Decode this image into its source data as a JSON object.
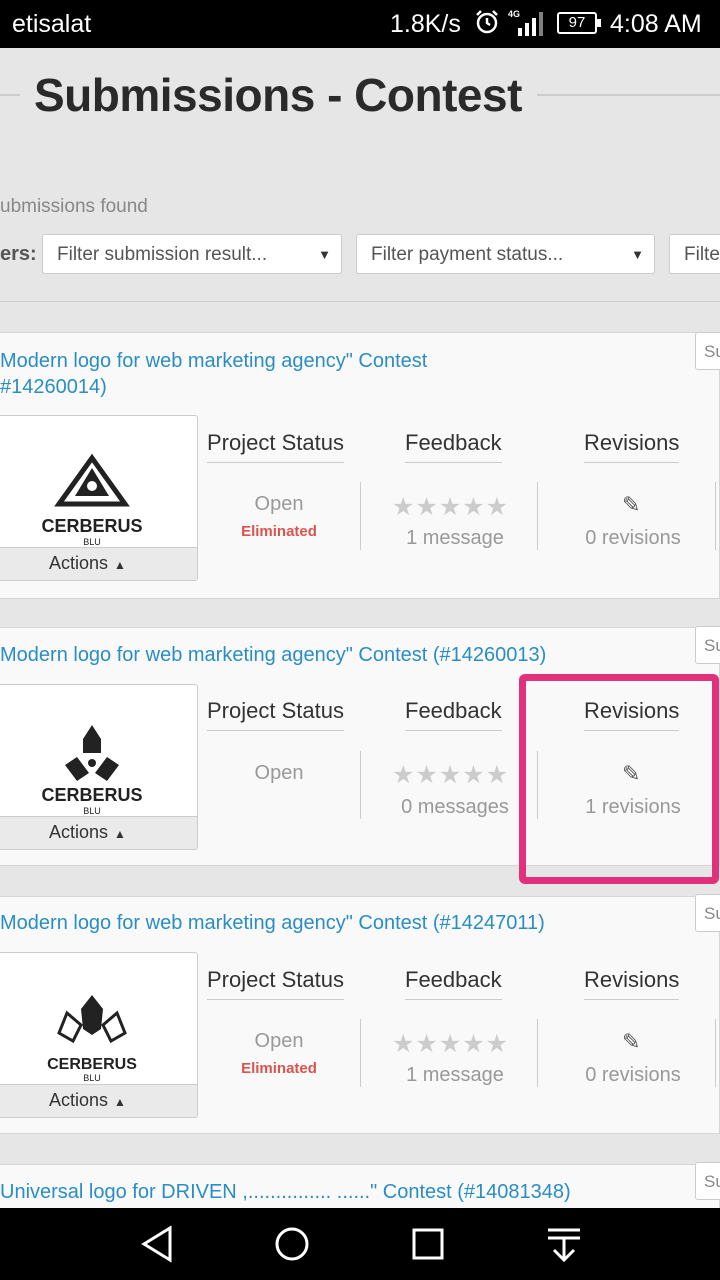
{
  "status_bar": {
    "carrier": "etisalat",
    "speed": "1.8K/s",
    "network": "4G",
    "battery": "97",
    "time": "4:08 AM"
  },
  "page": {
    "title": "Submissions - Contest",
    "found_text": "ubmissions found",
    "filters_label": "ers:",
    "filters": [
      {
        "placeholder": "Filter submission result..."
      },
      {
        "placeholder": "Filter payment status..."
      },
      {
        "placeholder": "Filte"
      }
    ]
  },
  "submissions": [
    {
      "title_line1": "Modern logo for web marketing agency\" Contest",
      "title_line2": "#14260014)",
      "tag": "Su",
      "logo_text": "CERBERUS",
      "logo_sub": "BLU",
      "actions_label": "Actions",
      "headers": {
        "status": "Project Status",
        "feedback": "Feedback",
        "revisions": "Revisions"
      },
      "status": "Open",
      "status_sub": "Eliminated",
      "stars": "★★★★★",
      "messages": "1 message",
      "revisions": "0 revisions"
    },
    {
      "title_line1": "Modern logo for web marketing agency\" Contest (#14260013)",
      "title_line2": "",
      "tag": "Su",
      "logo_text": "CERBERUS",
      "logo_sub": "BLU",
      "actions_label": "Actions",
      "headers": {
        "status": "Project Status",
        "feedback": "Feedback",
        "revisions": "Revisions"
      },
      "status": "Open",
      "status_sub": "",
      "stars": "★★★★★",
      "messages": "0 messages",
      "revisions": "1 revisions"
    },
    {
      "title_line1": "Modern logo for web marketing agency\" Contest (#14247011)",
      "title_line2": "",
      "tag": "Su",
      "logo_text": "CERBERUS",
      "logo_sub": "BLU",
      "actions_label": "Actions",
      "headers": {
        "status": "Project Status",
        "feedback": "Feedback",
        "revisions": "Revisions"
      },
      "status": "Open",
      "status_sub": "Eliminated",
      "stars": "★★★★★",
      "messages": "1 message",
      "revisions": "0 revisions"
    },
    {
      "title_line1": "Universal logo for DRIVEN ,............... ......\" Contest (#14081348)",
      "tag": "Su"
    }
  ],
  "colors": {
    "link": "#2a8dc4",
    "eliminated": "#d9534f",
    "highlight": "#e0317a"
  },
  "nav": {
    "icons": [
      "back-icon",
      "home-icon",
      "recents-icon",
      "notifications-down-icon"
    ]
  }
}
